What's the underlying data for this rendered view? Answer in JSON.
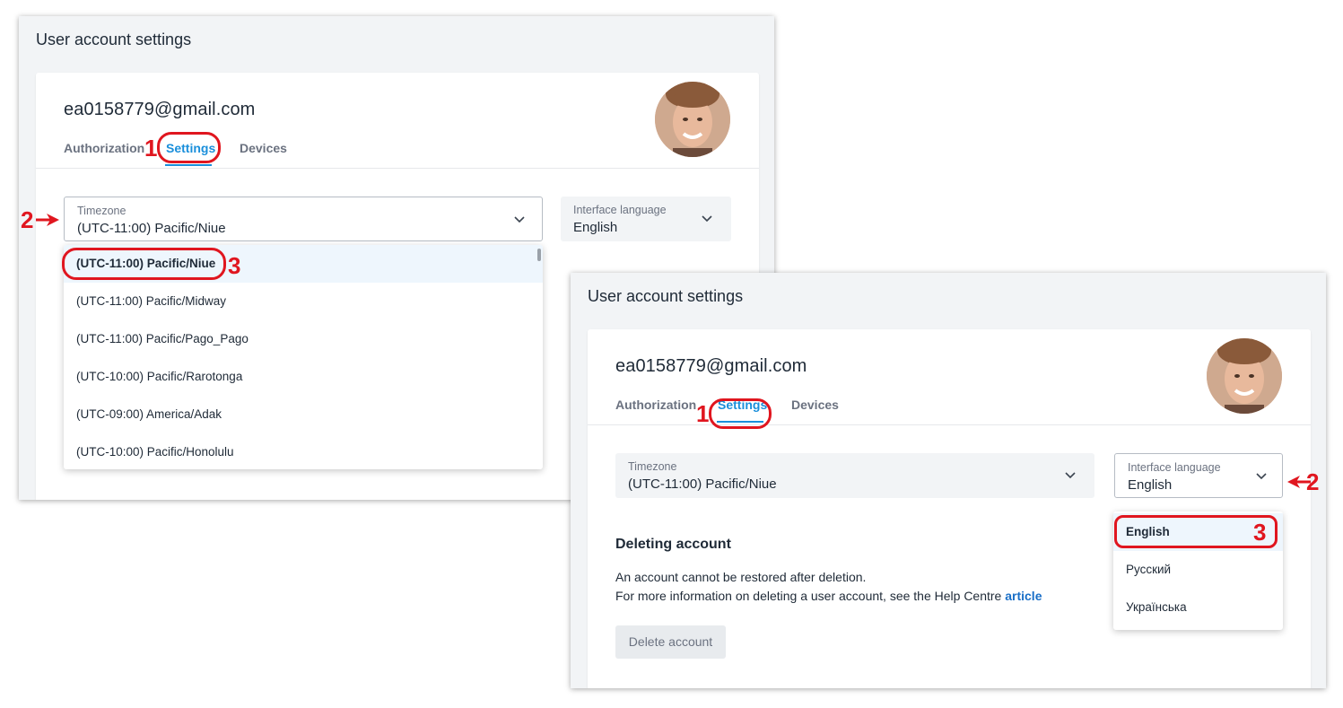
{
  "window_title": "User account settings",
  "email": "ea0158779@gmail.com",
  "tabs": [
    {
      "label": "Authorization"
    },
    {
      "label": "Settings"
    },
    {
      "label": "Devices"
    }
  ],
  "timezone": {
    "label": "Timezone",
    "value": "(UTC-11:00) Pacific/Niue",
    "options": [
      "(UTC-11:00) Pacific/Niue",
      "(UTC-11:00) Pacific/Midway",
      "(UTC-11:00) Pacific/Pago_Pago",
      "(UTC-10:00) Pacific/Rarotonga",
      "(UTC-09:00) America/Adak",
      "(UTC-10:00) Pacific/Honolulu"
    ]
  },
  "language": {
    "label": "Interface language",
    "value": "English",
    "options": [
      "English",
      "Русский",
      "Українська"
    ]
  },
  "deleting": {
    "title": "Deleting account",
    "line1": "An account cannot be restored after deletion.",
    "line2_prefix": "For more information on deleting a user account, see the Help Centre",
    "link": "article",
    "button": "Delete account"
  },
  "callouts": {
    "step1": "1",
    "step2": "2",
    "step3": "3"
  },
  "colors": {
    "accent": "#1a8fdb",
    "callout": "#e0161f",
    "link": "#1a6fc7"
  }
}
